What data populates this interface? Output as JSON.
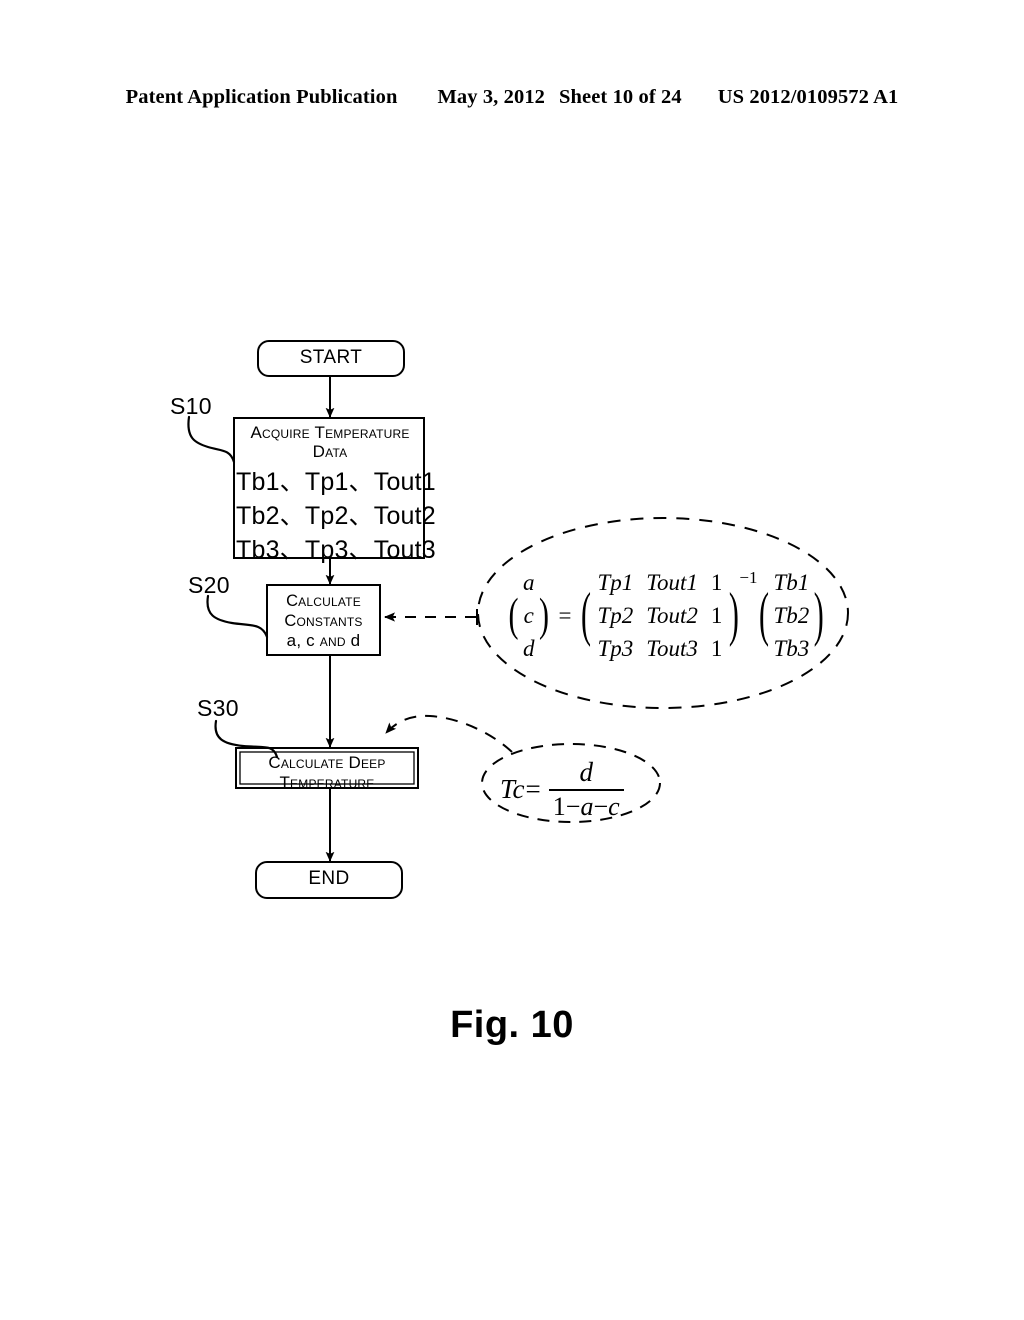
{
  "header": {
    "publication": "Patent Application Publication",
    "date": "May 3, 2012",
    "sheet": "Sheet 10 of 24",
    "publication_number": "US 2012/0109572 A1"
  },
  "figure": {
    "caption": "Fig. 10"
  },
  "flowchart": {
    "start_node": {
      "label": "START"
    },
    "end_node": {
      "label": "END"
    },
    "steps": [
      {
        "ref": "S10",
        "title_line_1": "Acquire Temperature",
        "title_line_2": "Data",
        "data_rows": [
          "Tb1、Tp1、Tout1",
          "Tb2、Tp2、Tout2",
          "Tb3、Tp3、Tout3"
        ]
      },
      {
        "ref": "S20",
        "title_line_1": "Calculate",
        "title_line_2": "Constants",
        "detail_prefix": "a, c ",
        "detail_keyword": "and",
        "detail_suffix": " d"
      },
      {
        "ref": "S30",
        "title_line_1": "Calculate Deep",
        "title_line_2": "Temperature"
      }
    ]
  },
  "annotations": {
    "matrix_equation": {
      "lhs_vector": [
        "a",
        "c",
        "d"
      ],
      "equals": "=",
      "matrix_rows": [
        [
          "Tp1",
          "Tout1",
          "1"
        ],
        [
          "Tp2",
          "Tout2",
          "1"
        ],
        [
          "Tp3",
          "Tout3",
          "1"
        ]
      ],
      "matrix_exponent": "−1",
      "rhs_vector": [
        "Tb1",
        "Tb2",
        "Tb3"
      ]
    },
    "tc_equation": {
      "lhs": "Tc",
      "equals": "=",
      "numerator": "d",
      "denominator_one": "1",
      "denominator_op1": "−",
      "denominator_a": "a",
      "denominator_op2": "−",
      "denominator_c": "c"
    }
  },
  "style": {
    "ink": "#000000",
    "paper": "#ffffff"
  }
}
